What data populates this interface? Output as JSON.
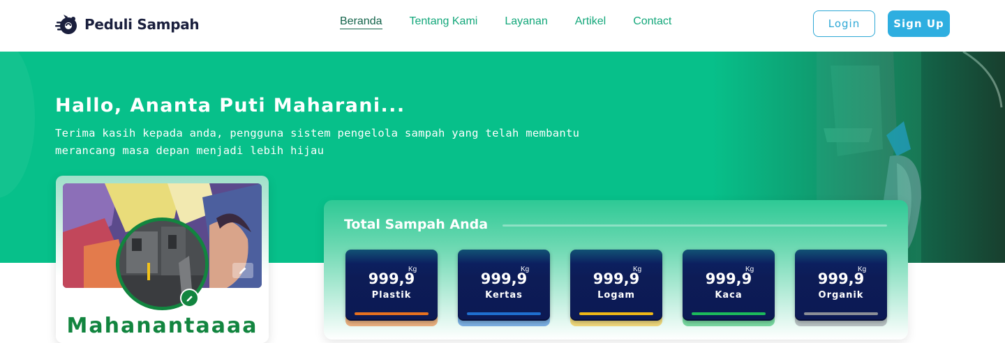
{
  "brand": {
    "name": "Peduli Sampah"
  },
  "nav": {
    "links": [
      {
        "label": "Beranda",
        "active": true
      },
      {
        "label": "Tentang Kami",
        "active": false
      },
      {
        "label": "Layanan",
        "active": false
      },
      {
        "label": "Artikel",
        "active": false
      },
      {
        "label": "Contact",
        "active": false
      }
    ],
    "login_label": "Login",
    "signup_label": "Sign Up"
  },
  "hero": {
    "title": "Hallo, Ananta Puti Maharani...",
    "subtitle": "Terima kasih kepada anda, pengguna sistem pengelola sampah yang telah membantu merancang masa depan menjadi lebih hijau"
  },
  "profile": {
    "name": "Mahanantaaaa",
    "cover_edit_icon": "pencil-icon",
    "avatar_edit_icon": "pencil-icon"
  },
  "total": {
    "title": "Total Sampah Anda",
    "unit": "Kg",
    "items": [
      {
        "value": "999,9",
        "label": "Plastik",
        "color": "#e8711f"
      },
      {
        "value": "999,9",
        "label": "Kertas",
        "color": "#1f6fd0"
      },
      {
        "value": "999,9",
        "label": "Logam",
        "color": "#f0b816"
      },
      {
        "value": "999,9",
        "label": "Kaca",
        "color": "#1cba5b"
      },
      {
        "value": "999,9",
        "label": "Organik",
        "color": "#8c8f97"
      }
    ]
  },
  "colors": {
    "primary": "#07c08a",
    "brand_dark": "#12853f",
    "nav_link": "#13a77a",
    "button_blue": "#2eaee0",
    "card_navy": "#0c1954"
  }
}
